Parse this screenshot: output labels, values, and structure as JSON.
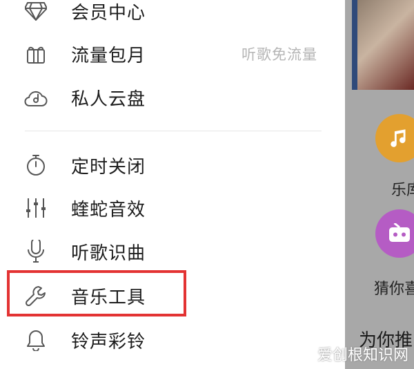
{
  "drawer": {
    "items": [
      {
        "label": "会员中心",
        "icon": "diamond-icon"
      },
      {
        "label": "流量包月",
        "icon": "gift-icon",
        "right": "听歌免流量"
      },
      {
        "label": "私人云盘",
        "icon": "cloud-icon"
      },
      {
        "label": "定时关闭",
        "icon": "timer-icon"
      },
      {
        "label": "蝰蛇音效",
        "icon": "equalizer-icon"
      },
      {
        "label": "听歌识曲",
        "icon": "mic-icon"
      },
      {
        "label": "音乐工具",
        "icon": "wrench-icon"
      },
      {
        "label": "铃声彩铃",
        "icon": "bell-icon"
      }
    ],
    "highlight_color": "#e33333"
  },
  "background": {
    "tiles": [
      {
        "label": "乐库",
        "color": "#e8a030",
        "icon": "music-note-icon"
      },
      {
        "label": "猜你喜",
        "color": "#b75bc3",
        "icon": "radio-icon"
      }
    ],
    "heading": "为你推"
  },
  "watermark": "爱创根知识网"
}
